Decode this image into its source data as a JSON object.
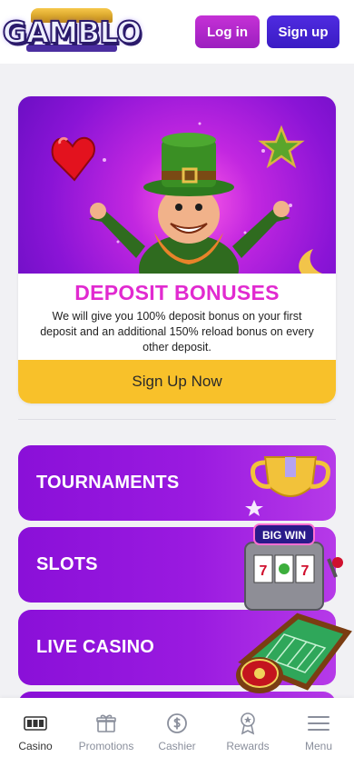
{
  "header": {
    "logo_text": "GAMBLO",
    "login_label": "Log in",
    "signup_label": "Sign up"
  },
  "promo": {
    "title": "DEPOSIT BONUSES",
    "description": "We will give you 100% deposit bonus on your first deposit and an additional 150% reload bonus on every other deposit.",
    "cta_label": "Sign Up Now"
  },
  "categories": [
    {
      "label": "TOURNAMENTS",
      "icon": "trophy-icon"
    },
    {
      "label": "SLOTS",
      "icon": "slot-machine-icon"
    },
    {
      "label": "LIVE CASINO",
      "icon": "roulette-table-icon"
    }
  ],
  "bottom_nav": [
    {
      "label": "Casino",
      "icon": "slot-reels-icon",
      "active": true
    },
    {
      "label": "Promotions",
      "icon": "gift-icon"
    },
    {
      "label": "Cashier",
      "icon": "dollar-coin-icon"
    },
    {
      "label": "Rewards",
      "icon": "award-badge-icon"
    },
    {
      "label": "Menu",
      "icon": "hamburger-icon"
    }
  ],
  "colors": {
    "brand_purple": "#8a10d8",
    "signup_blue": "#3a1cc4",
    "login_magenta": "#b628cc",
    "promo_title": "#e12ad0",
    "cta_yellow": "#f8c12a"
  }
}
